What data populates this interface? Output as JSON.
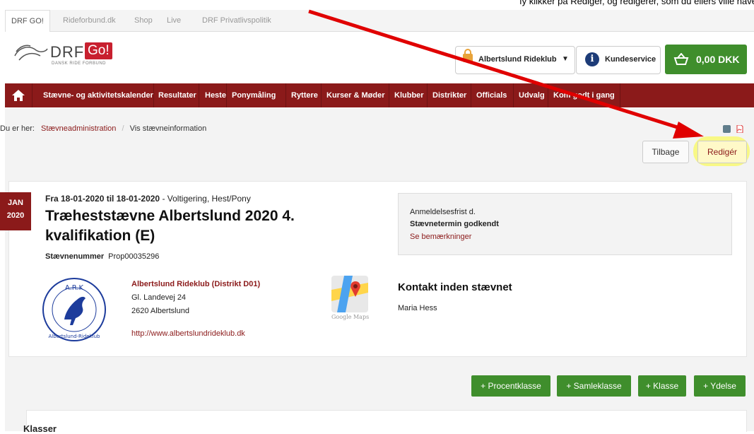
{
  "note_text": "ıy klikker på Redigér, og redigerer, som du ellers ville have gjort",
  "tabs": [
    "DRF GO!",
    "Rideforbund.dk",
    "Shop",
    "Live",
    "DRF Privatlivspolitik"
  ],
  "logo": {
    "drf": "DRF",
    "go": "Go!",
    "sub": "DANSK RIDE FORBUND"
  },
  "header": {
    "club": "Albertslund Rideklub",
    "caret": "▼",
    "service": "Kundeservice",
    "cart_total": "0,00 DKK",
    "info_glyph": "i",
    "basket_glyph": "🧺"
  },
  "nav": {
    "home_glyph": "⌂",
    "items": [
      "Stævne- og aktivitetskalender",
      "Resultater",
      "Heste",
      "Ponymåling",
      "Ryttere",
      "Kurser & Møder",
      "Klubber",
      "Distrikter",
      "Officials",
      "Udvalg",
      "Kom godt i gang"
    ]
  },
  "breadcrumb": {
    "prefix": "Du er her:",
    "items": [
      "Stævneadministration",
      "Vis stævneinformation"
    ],
    "separator": "/"
  },
  "actions": {
    "back": "Tilbage",
    "edit": "Redigér"
  },
  "event": {
    "month": "JAN",
    "year": "2020",
    "dates": "Fra 18-01-2020 til 18-01-2020",
    "type": " - Voltigering, Hest/Pony",
    "title": "Træheststævne Albertslund 2020 4. kvalifikation (E)",
    "number_label": "Stævnenummer",
    "number": "Prop00035296"
  },
  "club": {
    "name": "Albertslund Rideklub (Distrikt D01)",
    "address": "Gl. Landevej 24",
    "city": "2620 Albertslund",
    "url": "http://www.albertslundrideklub.dk",
    "logo_text": "A.R.K",
    "logo_ring": "Albertslund-Rideklub"
  },
  "maps_label": "Google Maps",
  "contact": {
    "title": "Kontakt inden stævnet",
    "name": "Maria Hess"
  },
  "status_box": {
    "deadline": "Anmeldelsesfrist d.",
    "status": "Stævnetermin godkendt",
    "remarks": "Se bemærkninger"
  },
  "add_buttons": [
    "+ Procentklasse",
    "+ Samleklasse",
    "+ Klasse",
    "+ Ydelse"
  ],
  "section_title": "Klasser",
  "colors": {
    "brand_red": "#8b1a1a",
    "green": "#3f8e2c",
    "highlight": "#ffff00",
    "arrow": "#e00000"
  }
}
